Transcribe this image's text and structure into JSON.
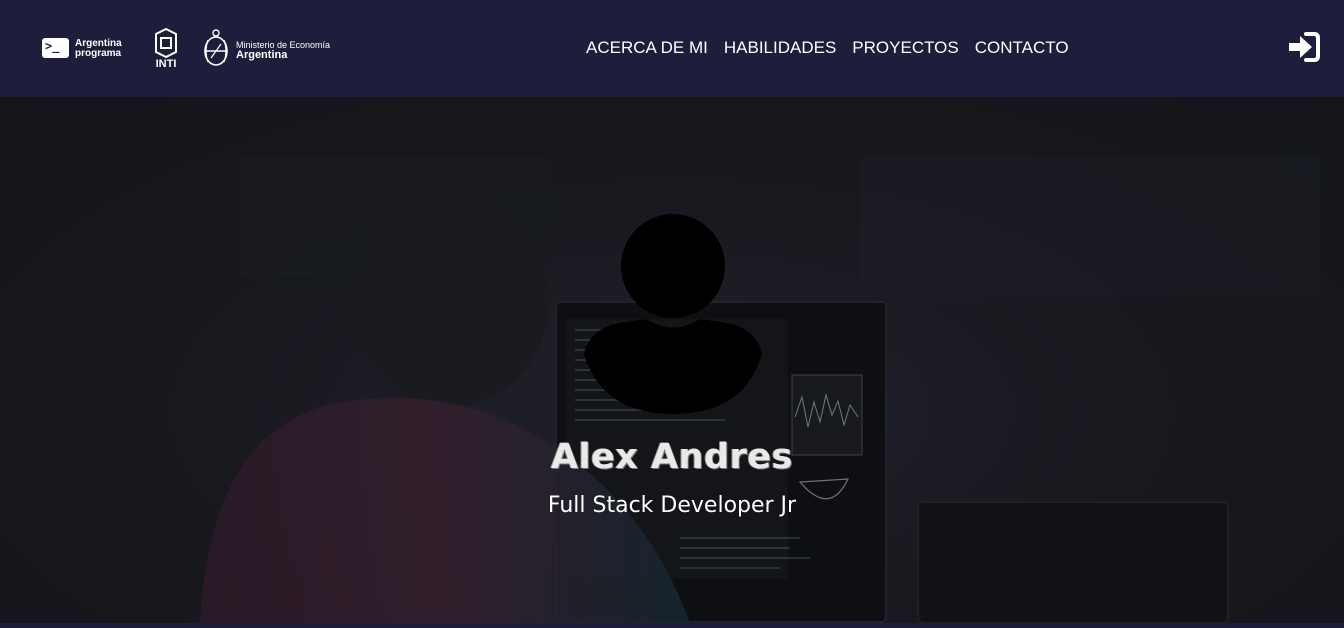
{
  "header": {
    "logo_argentina_programa": "Argentina programa",
    "logo_inti": "INTI",
    "logo_ministerio_line1": "Ministerio de Economía",
    "logo_ministerio_line2": "Argentina",
    "nav": [
      {
        "label": "ACERCA DE MI"
      },
      {
        "label": "HABILIDADES"
      },
      {
        "label": "PROYECTOS"
      },
      {
        "label": "CONTACTO"
      }
    ],
    "login_icon": "sign-in-icon"
  },
  "hero": {
    "avatar_icon": "user-icon",
    "name": "Alex Andres",
    "role": "Full Stack Developer Jr"
  },
  "colors": {
    "navbar_bg": "#1e1d3b",
    "hero_bg": "#1f2127",
    "text": "#ffffff"
  }
}
